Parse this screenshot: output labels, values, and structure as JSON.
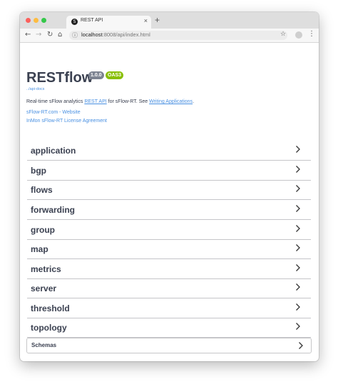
{
  "browser": {
    "tab_title": "REST API",
    "tab_favicon": "S",
    "tab_close": "×",
    "new_tab": "+",
    "url_host": "localhost",
    "url_path": ":8008/api/index.html",
    "icons": [
      "back-icon",
      "forward-icon",
      "reload-icon",
      "home-icon",
      "info-icon",
      "star-icon",
      "profile-icon",
      "menu-icon"
    ]
  },
  "header": {
    "title": "RESTflow",
    "version_badge": "1.0.0",
    "oas_badge": "OAS3",
    "api_link": "../api-docs",
    "desc_before": "Real-time sFlow analytics ",
    "desc_link1": "REST API",
    "desc_middle": " for sFlow-RT. See ",
    "desc_link2": "Writing Applications",
    "desc_after": ".",
    "website_link": "sFlow-RT.com - Website",
    "license_link": "InMon sFlow-RT License Agreement"
  },
  "colors": {
    "link": "#4990e2",
    "text": "#3b4151",
    "version_badge": "#7d8492",
    "oas_badge": "#89bf04"
  },
  "groups": [
    {
      "name": "application"
    },
    {
      "name": "bgp"
    },
    {
      "name": "flows"
    },
    {
      "name": "forwarding"
    },
    {
      "name": "group"
    },
    {
      "name": "map"
    },
    {
      "name": "metrics"
    },
    {
      "name": "server"
    },
    {
      "name": "threshold"
    },
    {
      "name": "topology"
    }
  ],
  "schemas": {
    "label": "Schemas"
  }
}
